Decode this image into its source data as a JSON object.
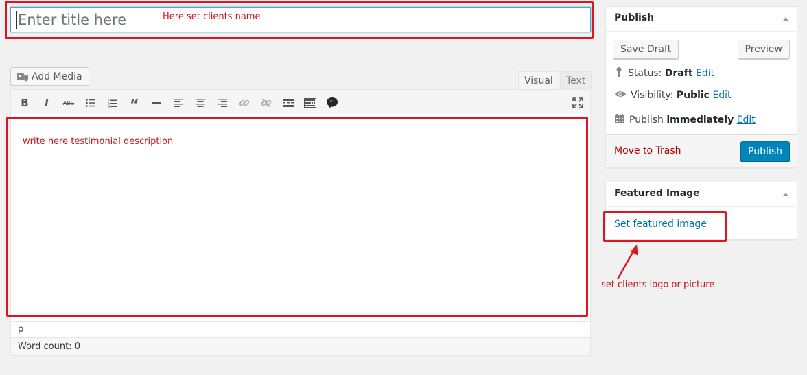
{
  "title": {
    "placeholder": "Enter title here",
    "annotation": "Here set clients name"
  },
  "media": {
    "add_media_label": "Add Media"
  },
  "editor": {
    "tab_visual": "Visual",
    "tab_text": "Text",
    "toolbar_icons": [
      "bold-icon",
      "italic-icon",
      "strikethrough-icon",
      "bulleted-list-icon",
      "numbered-list-icon",
      "blockquote-icon",
      "horizontal-line-icon",
      "align-left-icon",
      "align-center-icon",
      "align-right-icon",
      "insert-link-icon",
      "remove-link-icon",
      "read-more-icon",
      "toolbar-toggle-icon",
      "comment-bubble-icon",
      "fullscreen-icon"
    ],
    "annotation": "write here testimonial description",
    "path": "p",
    "word_count": "Word count: 0"
  },
  "publish": {
    "heading": "Publish",
    "save_draft": "Save Draft",
    "preview": "Preview",
    "status_label": "Status:",
    "status_value": "Draft",
    "visibility_label": "Visibility:",
    "visibility_value": "Public",
    "publish_label": "Publish",
    "publish_value": "immediately",
    "edit_label": "Edit",
    "move_to_trash": "Move to Trash",
    "publish_button": "Publish"
  },
  "featured_image": {
    "heading": "Featured Image",
    "set_link": "Set featured image",
    "annotation": "set clients logo or picture"
  },
  "colors": {
    "annotation_red": "#e0141e",
    "primary_blue": "#0085ba",
    "link_blue": "#0073aa",
    "trash_red": "#a00"
  }
}
